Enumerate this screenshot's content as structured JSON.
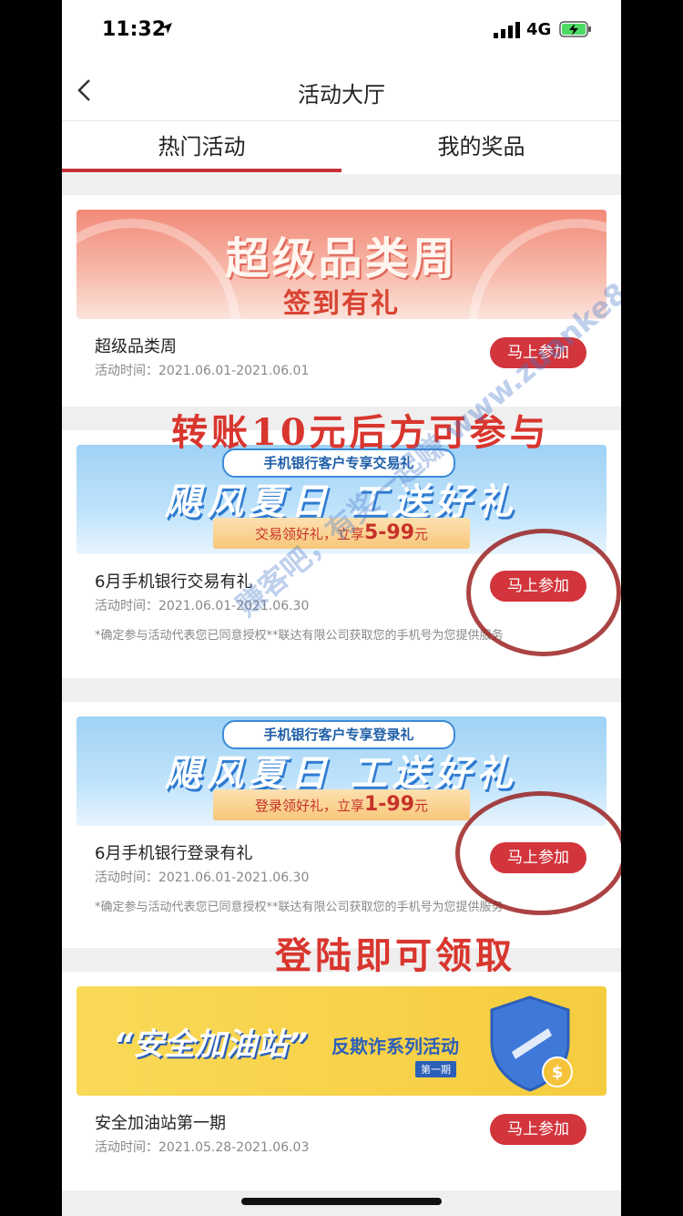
{
  "status_bar": {
    "time": "11:32",
    "network": "4G"
  },
  "nav": {
    "title": "活动大厅"
  },
  "tabs": [
    {
      "label": "热门活动",
      "active": true
    },
    {
      "label": "我的奖品",
      "active": false
    }
  ],
  "cards": [
    {
      "banner": {
        "title": "超级品类周",
        "subtitle": "签到有礼"
      },
      "title": "超级品类周",
      "time": "活动时间：2021.06.01-2021.06.01",
      "button": "马上参加"
    },
    {
      "banner": {
        "pill": "手机银行客户专享交易礼",
        "title": "飓风夏日  工送好礼",
        "ribbon_prefix": "交易领好礼，立享",
        "ribbon_amount": "5-99",
        "ribbon_unit": "元"
      },
      "title": "6月手机银行交易有礼",
      "time": "活动时间：2021.06.01-2021.06.30",
      "note": "*确定参与活动代表您已同意授权**联达有限公司获取您的手机号为您提供服务",
      "button": "马上参加"
    },
    {
      "banner": {
        "pill": "手机银行客户专享登录礼",
        "title": "飓风夏日  工送好礼",
        "ribbon_prefix": "登录领好礼，立享",
        "ribbon_amount": "1-99",
        "ribbon_unit": "元"
      },
      "title": "6月手机银行登录有礼",
      "time": "活动时间：2021.06.01-2021.06.30",
      "note": "*确定参与活动代表您已同意授权**联达有限公司获取您的手机号为您提供服务",
      "button": "马上参加"
    },
    {
      "banner": {
        "title": "“安全加油站”",
        "subtitle": "反欺诈系列活动",
        "tag": "第一期"
      },
      "title": "安全加油站第一期",
      "time": "活动时间：2021.05.28-2021.06.03",
      "button": "马上参加"
    }
  ],
  "annotations": {
    "top": "转账10元后方可参与",
    "bottom": "登陆即可领取",
    "watermark": "赚客吧，有奖一起赚 www.zuanke8.com"
  },
  "colors": {
    "accent": "#d2353c",
    "tab_underline": "#c8303a"
  }
}
